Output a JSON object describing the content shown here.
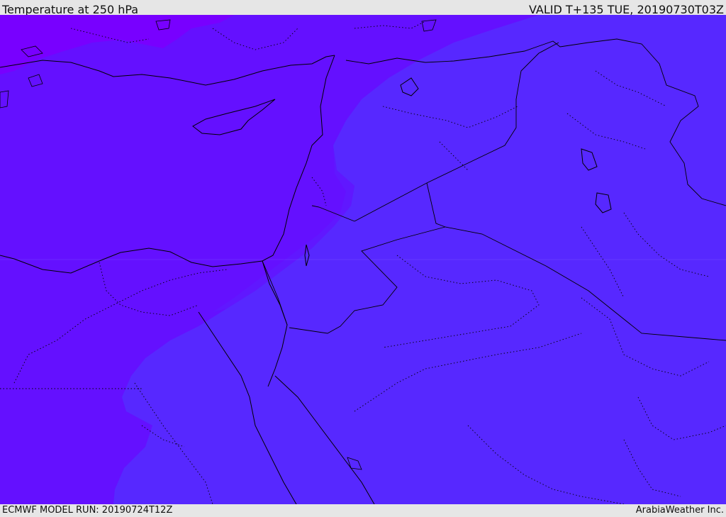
{
  "header": {
    "title": "Temperature at 250 hPa",
    "valid": "VALID T+135 TUE, 20190730T03Z"
  },
  "footer": {
    "model_run": "ECMWF MODEL RUN: 20190724T12Z",
    "credit": "ArabiaWeather Inc."
  },
  "colors": {
    "background": "#e6e6e6",
    "field_warm": "#6a10ff",
    "field_mid": "#5c20ff",
    "field_cool": "#5728ff",
    "field_hot": "#7a00ff",
    "borders": "#000000"
  }
}
